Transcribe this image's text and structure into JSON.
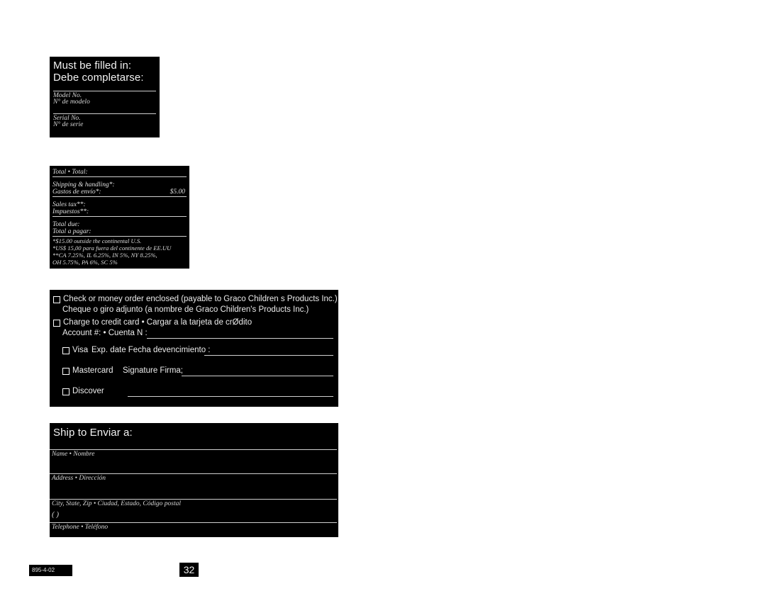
{
  "document": {
    "background_color": "#ffffff",
    "panel_color": "#000000",
    "text_color": "#e8e8e8"
  },
  "model_box": {
    "heading_en": "Must be filled in:",
    "heading_es": "Debe completarse:",
    "fields": [
      {
        "label_en": "Model No.",
        "label_es": "N° de modelo",
        "value": ""
      },
      {
        "label_en": "Serial No.",
        "label_es": "N° de serie",
        "value": ""
      }
    ]
  },
  "totals_box": {
    "rows": [
      {
        "label_en": "Total • Total:",
        "label_es": "",
        "amount": ""
      },
      {
        "label_en": "Shipping & handling*:",
        "label_es": "Gastos de envío*:",
        "amount": "$5.00"
      },
      {
        "label_en": "Sales tax**:",
        "label_es": "Impuestos**:",
        "amount": ""
      },
      {
        "label_en": "Total due:",
        "label_es": "Total a pagar:",
        "amount": ""
      }
    ],
    "footnotes": [
      "*$15.00 outside the continental U.S.",
      "*US$ 15,00 para fuera del continente de EE.UU",
      "**CA 7.25%, IL 6.25%, IN 5%, NY 8.25%,",
      "OH 5.75%, PA 6%, SC 5%"
    ]
  },
  "payment_box": {
    "check_option": {
      "line_en": "Check or money order enclosed  (payable to Graco Children s Products Inc.)",
      "line_es": "Cheque o giro adjunto  (a nombre de Graco Children's Products Inc.)"
    },
    "credit_option": {
      "line": "Charge to credit card • Cargar a la tarjeta de crØdito",
      "account_label": "Account #: • Cuenta N :",
      "account_value": ""
    },
    "cards": [
      {
        "name": "Visa",
        "extra_label": "Exp. date   Fecha devencimiento :",
        "value": ""
      },
      {
        "name": "Mastercard",
        "extra_label": "Signature   Firma;",
        "value": ""
      },
      {
        "name": "Discover",
        "extra_label": "",
        "value": ""
      }
    ]
  },
  "ship_box": {
    "heading": "Ship to   Enviar a:",
    "fields": [
      {
        "label": "Name • Nombre",
        "value": ""
      },
      {
        "label": "Address • Dirección",
        "value": ""
      },
      {
        "label": "City, State, Zip • Ciudad, Estado, Código postal",
        "value": ""
      },
      {
        "label": "Telephone • Teléfono",
        "value": "",
        "prefix": "(            )"
      }
    ]
  },
  "footer": {
    "doc_code": "895-4-02",
    "page_number": "32"
  }
}
